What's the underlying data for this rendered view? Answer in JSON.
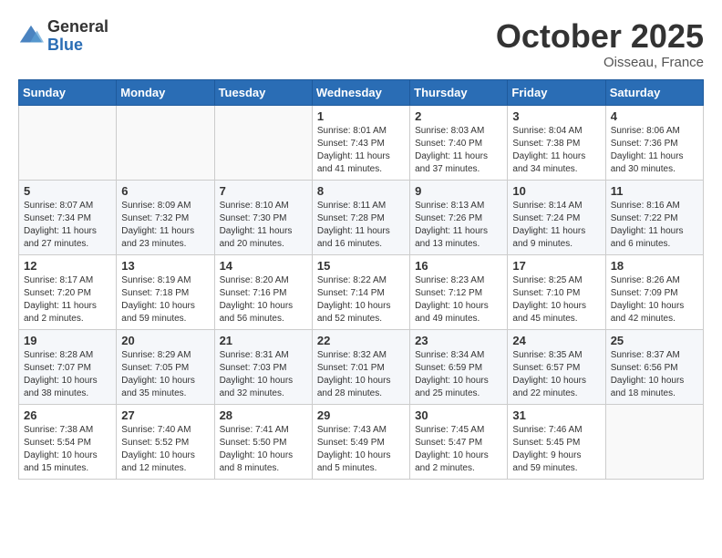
{
  "header": {
    "logo_general": "General",
    "logo_blue": "Blue",
    "month": "October 2025",
    "location": "Oisseau, France"
  },
  "weekdays": [
    "Sunday",
    "Monday",
    "Tuesday",
    "Wednesday",
    "Thursday",
    "Friday",
    "Saturday"
  ],
  "weeks": [
    [
      {
        "day": "",
        "info": ""
      },
      {
        "day": "",
        "info": ""
      },
      {
        "day": "",
        "info": ""
      },
      {
        "day": "1",
        "info": "Sunrise: 8:01 AM\nSunset: 7:43 PM\nDaylight: 11 hours\nand 41 minutes."
      },
      {
        "day": "2",
        "info": "Sunrise: 8:03 AM\nSunset: 7:40 PM\nDaylight: 11 hours\nand 37 minutes."
      },
      {
        "day": "3",
        "info": "Sunrise: 8:04 AM\nSunset: 7:38 PM\nDaylight: 11 hours\nand 34 minutes."
      },
      {
        "day": "4",
        "info": "Sunrise: 8:06 AM\nSunset: 7:36 PM\nDaylight: 11 hours\nand 30 minutes."
      }
    ],
    [
      {
        "day": "5",
        "info": "Sunrise: 8:07 AM\nSunset: 7:34 PM\nDaylight: 11 hours\nand 27 minutes."
      },
      {
        "day": "6",
        "info": "Sunrise: 8:09 AM\nSunset: 7:32 PM\nDaylight: 11 hours\nand 23 minutes."
      },
      {
        "day": "7",
        "info": "Sunrise: 8:10 AM\nSunset: 7:30 PM\nDaylight: 11 hours\nand 20 minutes."
      },
      {
        "day": "8",
        "info": "Sunrise: 8:11 AM\nSunset: 7:28 PM\nDaylight: 11 hours\nand 16 minutes."
      },
      {
        "day": "9",
        "info": "Sunrise: 8:13 AM\nSunset: 7:26 PM\nDaylight: 11 hours\nand 13 minutes."
      },
      {
        "day": "10",
        "info": "Sunrise: 8:14 AM\nSunset: 7:24 PM\nDaylight: 11 hours\nand 9 minutes."
      },
      {
        "day": "11",
        "info": "Sunrise: 8:16 AM\nSunset: 7:22 PM\nDaylight: 11 hours\nand 6 minutes."
      }
    ],
    [
      {
        "day": "12",
        "info": "Sunrise: 8:17 AM\nSunset: 7:20 PM\nDaylight: 11 hours\nand 2 minutes."
      },
      {
        "day": "13",
        "info": "Sunrise: 8:19 AM\nSunset: 7:18 PM\nDaylight: 10 hours\nand 59 minutes."
      },
      {
        "day": "14",
        "info": "Sunrise: 8:20 AM\nSunset: 7:16 PM\nDaylight: 10 hours\nand 56 minutes."
      },
      {
        "day": "15",
        "info": "Sunrise: 8:22 AM\nSunset: 7:14 PM\nDaylight: 10 hours\nand 52 minutes."
      },
      {
        "day": "16",
        "info": "Sunrise: 8:23 AM\nSunset: 7:12 PM\nDaylight: 10 hours\nand 49 minutes."
      },
      {
        "day": "17",
        "info": "Sunrise: 8:25 AM\nSunset: 7:10 PM\nDaylight: 10 hours\nand 45 minutes."
      },
      {
        "day": "18",
        "info": "Sunrise: 8:26 AM\nSunset: 7:09 PM\nDaylight: 10 hours\nand 42 minutes."
      }
    ],
    [
      {
        "day": "19",
        "info": "Sunrise: 8:28 AM\nSunset: 7:07 PM\nDaylight: 10 hours\nand 38 minutes."
      },
      {
        "day": "20",
        "info": "Sunrise: 8:29 AM\nSunset: 7:05 PM\nDaylight: 10 hours\nand 35 minutes."
      },
      {
        "day": "21",
        "info": "Sunrise: 8:31 AM\nSunset: 7:03 PM\nDaylight: 10 hours\nand 32 minutes."
      },
      {
        "day": "22",
        "info": "Sunrise: 8:32 AM\nSunset: 7:01 PM\nDaylight: 10 hours\nand 28 minutes."
      },
      {
        "day": "23",
        "info": "Sunrise: 8:34 AM\nSunset: 6:59 PM\nDaylight: 10 hours\nand 25 minutes."
      },
      {
        "day": "24",
        "info": "Sunrise: 8:35 AM\nSunset: 6:57 PM\nDaylight: 10 hours\nand 22 minutes."
      },
      {
        "day": "25",
        "info": "Sunrise: 8:37 AM\nSunset: 6:56 PM\nDaylight: 10 hours\nand 18 minutes."
      }
    ],
    [
      {
        "day": "26",
        "info": "Sunrise: 7:38 AM\nSunset: 5:54 PM\nDaylight: 10 hours\nand 15 minutes."
      },
      {
        "day": "27",
        "info": "Sunrise: 7:40 AM\nSunset: 5:52 PM\nDaylight: 10 hours\nand 12 minutes."
      },
      {
        "day": "28",
        "info": "Sunrise: 7:41 AM\nSunset: 5:50 PM\nDaylight: 10 hours\nand 8 minutes."
      },
      {
        "day": "29",
        "info": "Sunrise: 7:43 AM\nSunset: 5:49 PM\nDaylight: 10 hours\nand 5 minutes."
      },
      {
        "day": "30",
        "info": "Sunrise: 7:45 AM\nSunset: 5:47 PM\nDaylight: 10 hours\nand 2 minutes."
      },
      {
        "day": "31",
        "info": "Sunrise: 7:46 AM\nSunset: 5:45 PM\nDaylight: 9 hours\nand 59 minutes."
      },
      {
        "day": "",
        "info": ""
      }
    ]
  ]
}
